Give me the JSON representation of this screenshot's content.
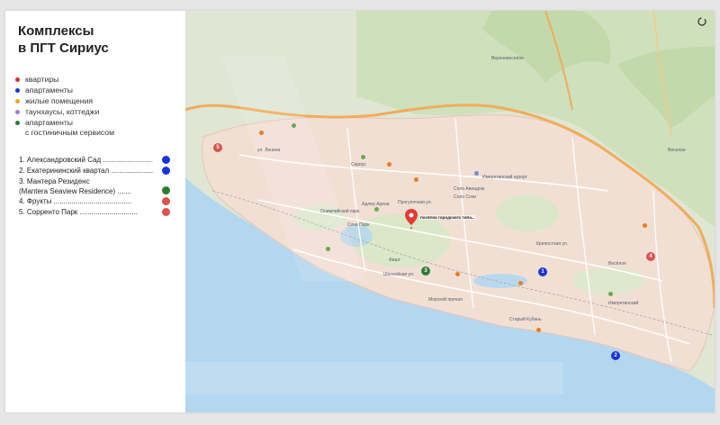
{
  "title": {
    "line1": "Комплексы",
    "line2": "в ПГТ Сириус"
  },
  "legend": [
    {
      "label": "квартиры",
      "color": "#d32f2f"
    },
    {
      "label": "апартаменты",
      "color": "#1a35d6"
    },
    {
      "label": "жилые помещения",
      "color": "#e3a91c"
    },
    {
      "label": "таунхаусы, коттеджи",
      "color": "#9b7fd1"
    },
    {
      "label": "апартаменты\nс гостиничным сервисом",
      "color": "#2e7d32"
    }
  ],
  "complexes": [
    {
      "label": "1. Александровский Сад .........................",
      "color": "#1a35d6"
    },
    {
      "label": "2. Екатерининский квартал .....................",
      "color": "#1a35d6"
    },
    {
      "label": "3. Мантера Резиденс\n(Mantera Seaview Residence) .......",
      "color": "#2e7d32"
    },
    {
      "label": "4. Фрукты .......................................",
      "color": "#d9534f"
    },
    {
      "label": "5. Сорренто Парк .............................",
      "color": "#d9534f"
    }
  ],
  "map": {
    "pin_label": "посёлок городского типа...",
    "labels": [
      {
        "text": "Веселое",
        "key": "veseloe"
      },
      {
        "text": "Верхневеселое",
        "key": "verhneveseloe"
      },
      {
        "text": "Весёлое",
        "key": "vesyoloe2"
      },
      {
        "text": "Соло Авиадом",
        "key": "solo"
      },
      {
        "text": "Имеретинский курорт",
        "key": "imeretinsky"
      },
      {
        "text": "Фишт",
        "key": "fisht"
      },
      {
        "text": "Сириус",
        "key": "sirius"
      },
      {
        "text": "Олимпийский парк",
        "key": "olimp_park"
      },
      {
        "text": "Адлер Арена",
        "key": "adler_arena"
      },
      {
        "text": "Сочи Парк",
        "key": "sochi_park"
      },
      {
        "text": "Шоссейная ул.",
        "key": "shosseynaya"
      },
      {
        "text": "ул. Ленина",
        "key": "lenina"
      },
      {
        "text": "Прогулочная ул.",
        "key": "progulochnaya"
      },
      {
        "text": "Крепостная ул.",
        "key": "krepostnaya"
      },
      {
        "text": "Имеретинский",
        "key": "imeretinsky2"
      },
      {
        "text": "Старый Кубань",
        "key": "stary_kuban"
      },
      {
        "text": "Морской причал",
        "key": "morskoy"
      },
      {
        "text": "Соло Сочи",
        "key": "solo_sochi"
      }
    ]
  },
  "colors": {
    "sea": "#b3d7ef",
    "land": "#f2dfd4",
    "green": "#cfe1bd",
    "road": "#f1ac5a"
  }
}
